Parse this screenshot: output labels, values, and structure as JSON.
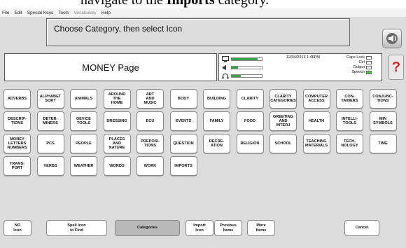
{
  "caption": {
    "pre": "navigate to the ",
    "bold": "Imports",
    "post": " category."
  },
  "menubar": [
    "File",
    "Edit",
    "Special Keys",
    "Tools",
    "Vocabulary",
    "Help"
  ],
  "message": "Choose Category, then select Icon",
  "page_title": "MONEY Page",
  "status": {
    "datetime": "12/04/2013 1:46PM",
    "flags": [
      {
        "label": "Caps Lock",
        "on": false
      },
      {
        "label": "Ctrl",
        "on": false
      },
      {
        "label": "Output",
        "on": false
      },
      {
        "label": "Speech",
        "on": true
      }
    ],
    "levels": [
      0.85,
      0.2,
      0.3
    ]
  },
  "help_label": "?",
  "categories": [
    [
      "ADVERBS",
      "ALPHABET\nSORT",
      "ANIMALS",
      "AROUND\nTHE\nHOME",
      "ART\nAND\nMUSIC",
      "BODY",
      "BUILDING",
      "CLARITY",
      "CLARITY\nCATEGORIES",
      "COMPUTER\nACCESS",
      "CON-\nTAINERS",
      "CONJUNC-\nTIONS"
    ],
    [
      "DESCRIP-\nTIONS",
      "DETER-\nMINERS",
      "DEVICE\nTOOLS",
      "DRESSING",
      "ECU",
      "EVENTS",
      "FAMILY",
      "FOOD",
      "GREETING\nAND\nINTERJ",
      "HEALTH",
      "INTELLI-\nTOOLS",
      "MIN\nSYMBOLS"
    ],
    [
      "MONEY\nLETTERS\nNUMBERS",
      "PCS",
      "PEOPLE",
      "PLACES\nAND\nNATURE",
      "PREPOSI-\nTIONS",
      "QUESTION",
      "RECRE-\nATION",
      "RELIGION",
      "SCHOOL",
      "TEACHING\nMATERIALS",
      "TECH-\nNOLOGY",
      "TIME"
    ],
    [
      "TRANS-\nPORT",
      "VERBS",
      "WEATHER",
      "WORDS",
      "WORK",
      "IMPORTS"
    ]
  ],
  "bottom": {
    "no_icon": "NO\nIcon",
    "spell": "Spell Icon\nto Find",
    "categories": "Categories",
    "import": "Import\nIcon",
    "previous": "Previous\nItems",
    "more": "More\nItems",
    "cancel": "Cancel"
  }
}
